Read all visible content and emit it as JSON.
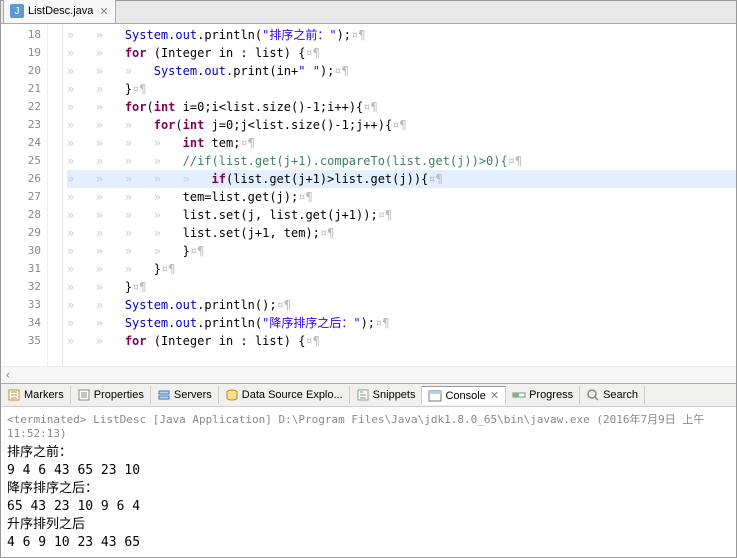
{
  "tab": {
    "label": "ListDesc.java",
    "icon": "J"
  },
  "lines": [
    {
      "n": 18,
      "ind": 2,
      "tokens": [
        {
          "c": "fld",
          "t": "System"
        },
        {
          "t": "."
        },
        {
          "c": "fld",
          "t": "out"
        },
        {
          "t": ".println("
        },
        {
          "c": "str",
          "t": "\"排序之前：\""
        },
        {
          "t": ");"
        }
      ],
      "tail": true
    },
    {
      "n": 19,
      "ind": 2,
      "tokens": [
        {
          "c": "kw",
          "t": "for"
        },
        {
          "t": " (Integer in : list) {"
        }
      ],
      "tail": true
    },
    {
      "n": 20,
      "ind": 3,
      "tokens": [
        {
          "c": "fld",
          "t": "System"
        },
        {
          "t": "."
        },
        {
          "c": "fld",
          "t": "out"
        },
        {
          "t": ".print(in+"
        },
        {
          "c": "str",
          "t": "\" \""
        },
        {
          "t": ");"
        }
      ],
      "tail": true
    },
    {
      "n": 21,
      "ind": 2,
      "tokens": [
        {
          "t": "}"
        }
      ],
      "tail": true
    },
    {
      "n": 22,
      "ind": 2,
      "tokens": [
        {
          "c": "kw",
          "t": "for"
        },
        {
          "t": "("
        },
        {
          "c": "kw",
          "t": "int"
        },
        {
          "t": " i=0;i<list.size()-1;i++){"
        }
      ],
      "tail": true
    },
    {
      "n": 23,
      "ind": 3,
      "tokens": [
        {
          "c": "kw",
          "t": "for"
        },
        {
          "t": "("
        },
        {
          "c": "kw",
          "t": "int"
        },
        {
          "t": " j=0;j<list.size()-1;j++){"
        }
      ],
      "tail": true
    },
    {
      "n": 24,
      "ind": 4,
      "tokens": [
        {
          "c": "kw",
          "t": "int"
        },
        {
          "t": " tem;"
        }
      ],
      "tail": true
    },
    {
      "n": 25,
      "ind": 4,
      "tokens": [
        {
          "c": "com",
          "t": "//if(list.get(j+1).compareTo(list.get(j))>0){"
        }
      ],
      "tail": true
    },
    {
      "n": 26,
      "ind": 5,
      "hl": true,
      "tokens": [
        {
          "c": "kw",
          "t": "if"
        },
        {
          "t": "(list.get(j+1)>list.get(j)){"
        }
      ],
      "tail": true
    },
    {
      "n": 27,
      "ind": 4,
      "tokens": [
        {
          "t": "tem=list.get(j);"
        }
      ],
      "tail": true
    },
    {
      "n": 28,
      "ind": 4,
      "tokens": [
        {
          "t": "list.set(j, list.get(j+1));"
        }
      ],
      "tail": true
    },
    {
      "n": 29,
      "ind": 4,
      "tokens": [
        {
          "t": "list.set(j+1, tem);"
        }
      ],
      "tail": true
    },
    {
      "n": 30,
      "ind": 4,
      "tokens": [
        {
          "t": "}"
        }
      ],
      "tail": true
    },
    {
      "n": 31,
      "ind": 3,
      "tokens": [
        {
          "t": "}"
        }
      ],
      "tail": true
    },
    {
      "n": 32,
      "ind": 2,
      "tokens": [
        {
          "t": "}"
        }
      ],
      "tail": true
    },
    {
      "n": 33,
      "ind": 2,
      "tokens": [
        {
          "c": "fld",
          "t": "System"
        },
        {
          "t": "."
        },
        {
          "c": "fld",
          "t": "out"
        },
        {
          "t": ".println();"
        }
      ],
      "tail": true
    },
    {
      "n": 34,
      "ind": 2,
      "tokens": [
        {
          "c": "fld",
          "t": "System"
        },
        {
          "t": "."
        },
        {
          "c": "fld",
          "t": "out"
        },
        {
          "t": ".println("
        },
        {
          "c": "str",
          "t": "\"降序排序之后：\""
        },
        {
          "t": ");"
        }
      ],
      "tail": true
    },
    {
      "n": 35,
      "ind": 2,
      "tokens": [
        {
          "c": "kw",
          "t": "for"
        },
        {
          "t": " (Integer in : list) {"
        }
      ],
      "tail": true
    }
  ],
  "views": [
    {
      "label": "Markers",
      "icon": "marker"
    },
    {
      "label": "Properties",
      "icon": "props"
    },
    {
      "label": "Servers",
      "icon": "servers"
    },
    {
      "label": "Data Source Explo...",
      "icon": "dse"
    },
    {
      "label": "Snippets",
      "icon": "snip"
    },
    {
      "label": "Console",
      "icon": "console",
      "active": true,
      "close": true
    },
    {
      "label": "Progress",
      "icon": "progress"
    },
    {
      "label": "Search",
      "icon": "search"
    }
  ],
  "terminated": "<terminated> ListDesc [Java Application] D:\\Program Files\\Java\\jdk1.8.0_65\\bin\\javaw.exe (2016年7月9日 上午11:52:13)",
  "output": [
    "排序之前：",
    "9 4 6 43 65 23 10 ",
    "降序排序之后：",
    "65 43 23 10 9 6 4 ",
    "升序排列之后",
    "4 6 9 10 23 43 65 "
  ]
}
